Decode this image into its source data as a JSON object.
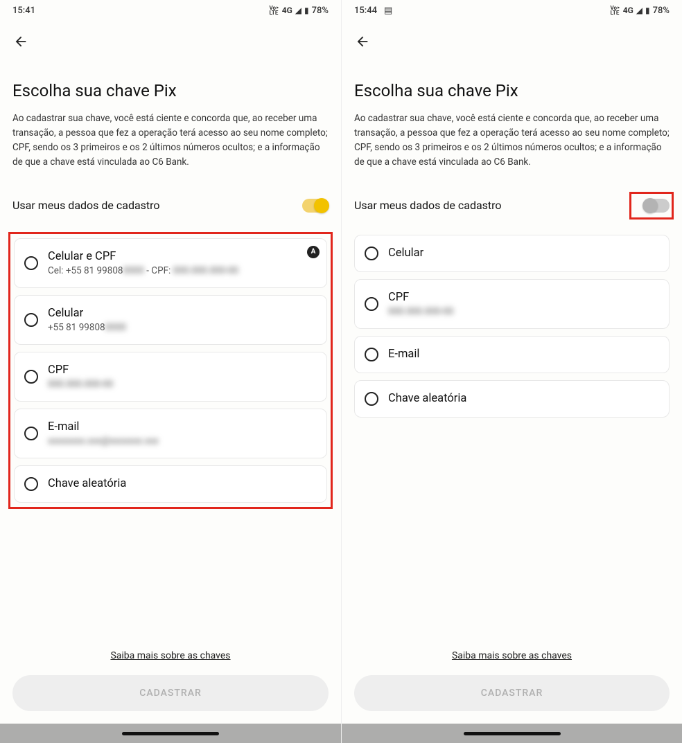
{
  "left": {
    "time": "15:41",
    "network_label": "4G",
    "battery": "78%",
    "title": "Escolha sua chave Pix",
    "description": "Ao cadastrar sua chave, você está ciente e concorda que, ao receber uma transação, a pessoa que fez a operação terá acesso ao seu nome completo; CPF, sendo os 3 primeiros e os 2 últimos números ocultos; e a informação de que a chave está vinculada ao C6 Bank.",
    "toggle_label": "Usar meus dados de cadastro",
    "options": [
      {
        "title": "Celular e CPF",
        "sub_prefix": "Cel: +55 81 99808",
        "sub_blur1": "0000",
        "sub_mid": " - CPF: ",
        "sub_blur2": "000.000.000-00",
        "badge": "A"
      },
      {
        "title": "Celular",
        "sub_prefix": "+55 81 99808",
        "sub_blur1": "0000"
      },
      {
        "title": "CPF",
        "sub_blur_full": "000.000.000-00"
      },
      {
        "title": "E-mail",
        "sub_blur_full": "xxxxxxxx.xxx@xxxxxxx.xxx"
      },
      {
        "title": "Chave aleatória"
      }
    ],
    "link": "Saiba mais sobre as chaves",
    "button": "CADASTRAR"
  },
  "right": {
    "time": "15:44",
    "network_label": "4G",
    "battery": "78%",
    "title": "Escolha sua chave Pix",
    "description": "Ao cadastrar sua chave, você está ciente e concorda que, ao receber uma transação, a pessoa que fez a operação terá acesso ao seu nome completo; CPF, sendo os 3 primeiros e os 2 últimos números ocultos; e a informação de que a chave está vinculada ao C6 Bank.",
    "toggle_label": "Usar meus dados de cadastro",
    "options": [
      {
        "title": "Celular"
      },
      {
        "title": "CPF",
        "sub_blur_full": "000.000.000-00"
      },
      {
        "title": "E-mail"
      },
      {
        "title": "Chave aleatória"
      }
    ],
    "link": "Saiba mais sobre as chaves",
    "button": "CADASTRAR"
  }
}
